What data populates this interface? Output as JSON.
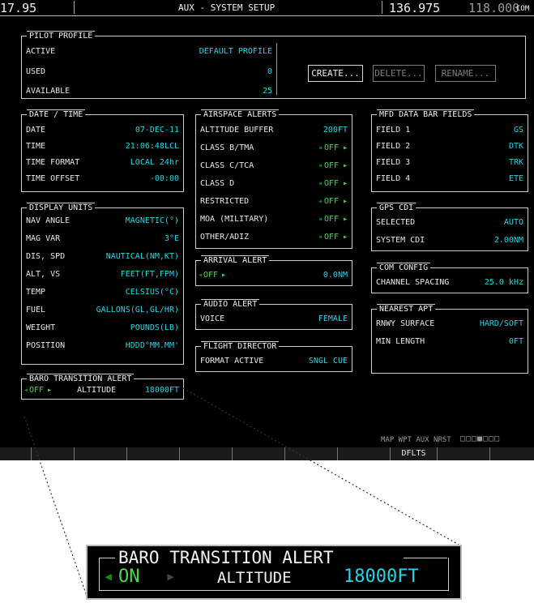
{
  "topbar": {
    "nav_freq": "17.95",
    "title": "AUX - SYSTEM SETUP",
    "com_active": "136.975",
    "com_standby": "118.000",
    "com_label": "COM"
  },
  "pilot_profile": {
    "title": "PILOT PROFILE",
    "rows": [
      {
        "label": "ACTIVE",
        "value": "DEFAULT PROFILE"
      },
      {
        "label": "USED",
        "value": "0"
      },
      {
        "label": "AVAILABLE",
        "value": "25"
      }
    ],
    "buttons": {
      "create": "CREATE...",
      "delete": "DELETE...",
      "rename": "RENAME..."
    }
  },
  "date_time": {
    "title": "DATE / TIME",
    "rows": [
      {
        "label": "DATE",
        "value": "07-DEC-11"
      },
      {
        "label": "TIME",
        "value": "21:06:48LCL"
      },
      {
        "label": "TIME FORMAT",
        "value": "LOCAL 24hr"
      },
      {
        "label": "TIME OFFSET",
        "value": "-00:00"
      }
    ]
  },
  "display_units": {
    "title": "DISPLAY UNITS",
    "rows": [
      {
        "label": "NAV ANGLE",
        "value": "MAGNETIC(°)"
      },
      {
        "label": "MAG VAR",
        "value": "3°E"
      },
      {
        "label": "DIS, SPD",
        "value": "NAUTICAL(NM,KT)"
      },
      {
        "label": "ALT, VS",
        "value": "FEET(FT,FPM)"
      },
      {
        "label": "TEMP",
        "value": "CELSIUS(°C)"
      },
      {
        "label": "FUEL",
        "value": "GALLONS(GL,GL/HR)"
      },
      {
        "label": "WEIGHT",
        "value": "POUNDS(LB)"
      },
      {
        "label": "POSITION",
        "value": "HDDD°MM.MM'"
      }
    ]
  },
  "baro_alert": {
    "title": "BARO TRANSITION ALERT",
    "state": "OFF",
    "altitude_label": "ALTITUDE",
    "altitude": "18000FT"
  },
  "airspace_alerts": {
    "title": "AIRSPACE ALERTS",
    "rows": [
      {
        "label": "ALTITUDE BUFFER",
        "value": "200FT"
      },
      {
        "label": "CLASS B/TMA",
        "value": "OFF"
      },
      {
        "label": "CLASS C/TCA",
        "value": "OFF"
      },
      {
        "label": "CLASS D",
        "value": "OFF"
      },
      {
        "label": "RESTRICTED",
        "value": "OFF"
      },
      {
        "label": "MOA (MILITARY)",
        "value": "OFF"
      },
      {
        "label": "OTHER/ADIZ",
        "value": "OFF"
      }
    ]
  },
  "arrival_alert": {
    "title": "ARRIVAL ALERT",
    "state": "OFF",
    "distance": "0.0NM"
  },
  "audio_alert": {
    "title": "AUDIO ALERT",
    "label": "VOICE",
    "value": "FEMALE"
  },
  "flight_director": {
    "title": "FLIGHT DIRECTOR",
    "label": "FORMAT ACTIVE",
    "value": "SNGL CUE"
  },
  "mfd_fields": {
    "title": "MFD DATA BAR FIELDS",
    "rows": [
      {
        "label": "FIELD 1",
        "value": "GS"
      },
      {
        "label": "FIELD 2",
        "value": "DTK"
      },
      {
        "label": "FIELD 3",
        "value": "TRK"
      },
      {
        "label": "FIELD 4",
        "value": "ETE"
      }
    ]
  },
  "gps_cdi": {
    "title": "GPS CDI",
    "rows": [
      {
        "label": "SELECTED",
        "value": "AUTO"
      },
      {
        "label": "SYSTEM CDI",
        "value": "2.00NM"
      }
    ]
  },
  "com_config": {
    "title": "COM CONFIG",
    "label": "CHANNEL SPACING",
    "value": "25.0 kHz"
  },
  "nearest_apt": {
    "title": "NEAREST APT",
    "rows": [
      {
        "label": "RNWY SURFACE",
        "value": "HARD/SOFT"
      },
      {
        "label": "MIN LENGTH",
        "value": "0FT"
      }
    ]
  },
  "page_group": {
    "text": "MAP WPT AUX NRST",
    "boxes": "□□□■□□□"
  },
  "softkeys": {
    "dflts": "DFLTS"
  },
  "zoom": {
    "title": "BARO TRANSITION ALERT",
    "state": "ON",
    "altitude_label": "ALTITUDE",
    "altitude": "18000FT"
  },
  "colors": {
    "screen_bg": "#000000",
    "cyan": "#22d6e8",
    "green": "#4ad84a",
    "frame": "#cfcfcf"
  }
}
